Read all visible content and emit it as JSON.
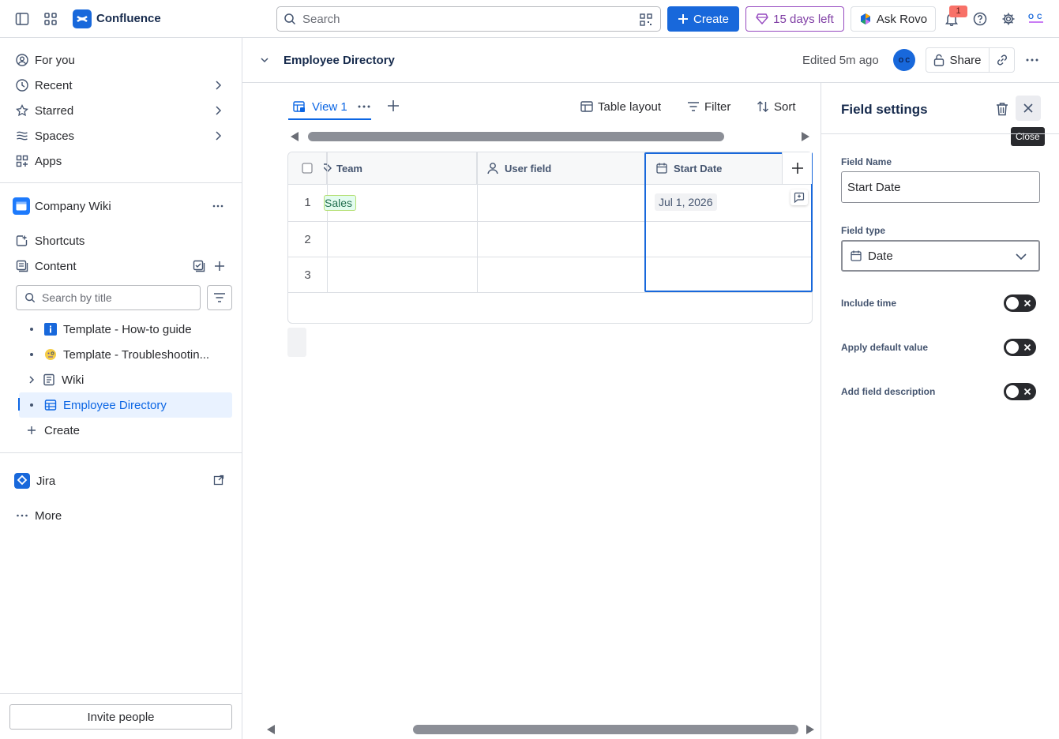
{
  "app": {
    "name": "Confluence",
    "search_placeholder": "Search",
    "create_label": "Create",
    "trial_label": "15 days left",
    "rovo_label": "Ask Rovo",
    "notification_count": "1",
    "brand_color": "#1868db"
  },
  "sidebar": {
    "nav": [
      {
        "label": "For you",
        "icon": "user-circle-icon"
      },
      {
        "label": "Recent",
        "icon": "clock-icon"
      },
      {
        "label": "Starred",
        "icon": "star-icon"
      },
      {
        "label": "Spaces",
        "icon": "spaces-icon"
      },
      {
        "label": "Apps",
        "icon": "apps-icon"
      }
    ],
    "space_name": "Company Wiki",
    "shortcuts_label": "Shortcuts",
    "content_label": "Content",
    "search_placeholder": "Search by title",
    "tree": [
      {
        "label": "Template - How-to guide",
        "icon": "info-icon"
      },
      {
        "label": "Template - Troubleshootin...",
        "icon": "emoji-icon"
      },
      {
        "label": "Wiki",
        "icon": "page-icon"
      },
      {
        "label": "Employee Directory",
        "icon": "database-icon",
        "active": true
      }
    ],
    "create_label": "Create",
    "jira_label": "Jira",
    "more_label": "More",
    "invite_label": "Invite people"
  },
  "page": {
    "title": "Employee Directory",
    "edited": "Edited 5m ago",
    "avatar_initials": "O C",
    "share_label": "Share"
  },
  "database": {
    "view_label": "View 1",
    "table_layout_label": "Table layout",
    "filter_label": "Filter",
    "sort_label": "Sort",
    "columns": [
      "Team",
      "User field",
      "Start Date"
    ],
    "rows": [
      {
        "num": "1",
        "team": "Sales",
        "user": "",
        "start_date": "Jul 1, 2026"
      },
      {
        "num": "2",
        "team": "",
        "user": "",
        "start_date": ""
      },
      {
        "num": "3",
        "team": "",
        "user": "",
        "start_date": ""
      }
    ]
  },
  "field_settings": {
    "title": "Field settings",
    "close_tooltip": "Close",
    "field_name_label": "Field Name",
    "field_name_value": "Start Date",
    "field_type_label": "Field type",
    "field_type_value": "Date",
    "toggles": [
      {
        "label": "Include time",
        "on": false
      },
      {
        "label": "Apply default value",
        "on": false
      },
      {
        "label": "Add field description",
        "on": false
      }
    ]
  }
}
